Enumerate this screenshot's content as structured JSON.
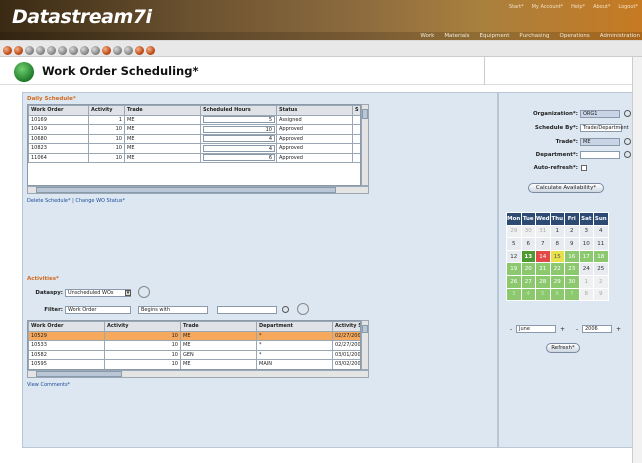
{
  "app": {
    "logo": "Datastream7i",
    "top_links": [
      "Start*",
      "My Account*",
      "Help*",
      "About*",
      "Logout*"
    ],
    "nav": [
      "Work",
      "Materials",
      "Equipment",
      "Purchasing",
      "Operations",
      "Administration"
    ]
  },
  "page": {
    "title": "Work Order Scheduling*"
  },
  "daily": {
    "title": "Daily Schedule*",
    "columns": [
      "Work Order",
      "Activity",
      "Trade",
      "Scheduled Hours",
      "Status",
      "S"
    ],
    "rows": [
      {
        "wo": "10169",
        "act": "1",
        "trade": "ME",
        "hours": "5",
        "status": "Assigned"
      },
      {
        "wo": "10419",
        "act": "10",
        "trade": "ME",
        "hours": "10",
        "status": "Approved"
      },
      {
        "wo": "10680",
        "act": "10",
        "trade": "ME",
        "hours": "4",
        "status": "Approved"
      },
      {
        "wo": "10823",
        "act": "10",
        "trade": "ME",
        "hours": "4",
        "status": "Approved"
      },
      {
        "wo": "11064",
        "act": "10",
        "trade": "ME",
        "hours": "6",
        "status": "Approved"
      }
    ],
    "links": "Delete Schedule* | Change WO Status*"
  },
  "activities": {
    "title": "Activities*",
    "dataspy_label": "Dataspy:",
    "dataspy_value": "Unscheduled WOs",
    "filter_label": "Filter:",
    "filter_field": "Work Order",
    "filter_op": "Begins with",
    "filter_value": "",
    "columns": [
      "Work Order",
      "Activity",
      "Trade",
      "Department",
      "Activity S"
    ],
    "rows": [
      {
        "wo": "10529",
        "act": "10",
        "trade": "ME",
        "dept": "*",
        "date": "02/27/200"
      },
      {
        "wo": "10533",
        "act": "10",
        "trade": "ME",
        "dept": "*",
        "date": "02/27/200"
      },
      {
        "wo": "10582",
        "act": "10",
        "trade": "GEN",
        "dept": "*",
        "date": "03/01/200"
      },
      {
        "wo": "10595",
        "act": "10",
        "trade": "ME",
        "dept": "MAIN",
        "date": "03/02/200"
      }
    ],
    "link": "View Comments*"
  },
  "right": {
    "org_label": "Organization*:",
    "org_value": "ORG1",
    "schedby_label": "Schedule By*:",
    "schedby_value": "Trade/Department",
    "trade_label": "Trade*:",
    "trade_value": "ME",
    "dept_label": "Department*:",
    "dept_value": "",
    "auto_label": "Auto-refresh*:",
    "calc_button": "Calculate Availability*",
    "refresh_button": "Refresh*",
    "month": "June",
    "year": "2006",
    "prev": "-",
    "next": "+"
  },
  "calendar": {
    "headers": [
      "Mon",
      "Tue",
      "Wed",
      "Thu",
      "Fri",
      "Sat",
      "Sun"
    ],
    "weeks": [
      [
        [
          "29",
          "o"
        ],
        [
          "30",
          "o"
        ],
        [
          "31",
          "o"
        ],
        [
          "1",
          ""
        ],
        [
          "2",
          ""
        ],
        [
          "3",
          ""
        ],
        [
          "4",
          ""
        ]
      ],
      [
        [
          "5",
          ""
        ],
        [
          "6",
          ""
        ],
        [
          "7",
          ""
        ],
        [
          "8",
          ""
        ],
        [
          "9",
          ""
        ],
        [
          "10",
          ""
        ],
        [
          "11",
          ""
        ]
      ],
      [
        [
          "12",
          ""
        ],
        [
          "13",
          "gb"
        ],
        [
          "14",
          "rd"
        ],
        [
          "15",
          "yl"
        ],
        [
          "16",
          "gr"
        ],
        [
          "17",
          "gr"
        ],
        [
          "18",
          "gr"
        ]
      ],
      [
        [
          "19",
          "gr"
        ],
        [
          "20",
          "gr"
        ],
        [
          "21",
          "gr"
        ],
        [
          "22",
          "gr"
        ],
        [
          "23",
          "gr"
        ],
        [
          "24",
          ""
        ],
        [
          "25",
          ""
        ]
      ],
      [
        [
          "26",
          "gr"
        ],
        [
          "27",
          "gr"
        ],
        [
          "28",
          "gr"
        ],
        [
          "29",
          "gr"
        ],
        [
          "30",
          "gr"
        ],
        [
          "1",
          "o"
        ],
        [
          "2",
          "o"
        ]
      ],
      [
        [
          "3",
          "gf"
        ],
        [
          "4",
          "gf"
        ],
        [
          "5",
          "gf"
        ],
        [
          "6",
          "gf"
        ],
        [
          "7",
          "gf"
        ],
        [
          "8",
          "o"
        ],
        [
          "9",
          "o"
        ]
      ]
    ]
  },
  "colors": {
    "accent": "#d2691e",
    "panel": "#dde7f1",
    "calendar_header": "#2d4a73",
    "available": "#8cc86e",
    "today": "#4e9a32",
    "overbooked": "#e24a4a",
    "partial": "#e8e04a",
    "selected_row": "#f6a85c"
  }
}
